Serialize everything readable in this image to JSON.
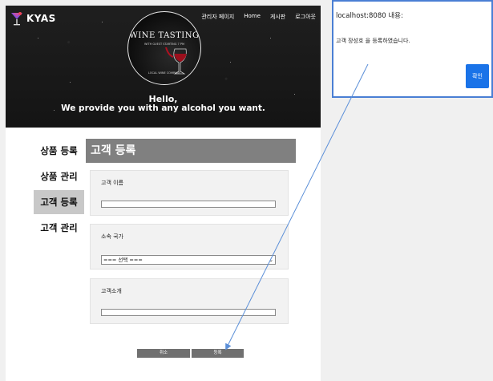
{
  "header": {
    "logo_text": "KYAS",
    "nav": [
      "관리자 페이지",
      "Home",
      "게시판",
      "로그아웃"
    ]
  },
  "hero": {
    "wine_title": "WINE TASTING",
    "wine_sub": "WITH GUEST  STARTING 7 PM",
    "wine_foot": "LOCAL WINE COMPANY",
    "hello": "Hello,",
    "tagline": "We provide you with any alcohol you want."
  },
  "sidebar": {
    "items": [
      "상품 등록",
      "상품 관리",
      "고객 등록",
      "고객 관리"
    ],
    "active_index": 2
  },
  "main": {
    "section_title": "고객 등록",
    "fields": {
      "name_label": "고객 이름",
      "country_label": "소속 국가",
      "country_selected": "=== 선택 ===",
      "intro_label": "고객소개"
    },
    "buttons": {
      "cancel": "취소",
      "submit": "등록"
    }
  },
  "dialog": {
    "title": "localhost:8080 내용:",
    "message": "고객 장성호 을 등록하였습니다.",
    "ok": "확인"
  },
  "colors": {
    "accent": "#1a73e8",
    "section_head": "#808080",
    "button": "#707070",
    "dialog_border": "#4a7fd4"
  }
}
